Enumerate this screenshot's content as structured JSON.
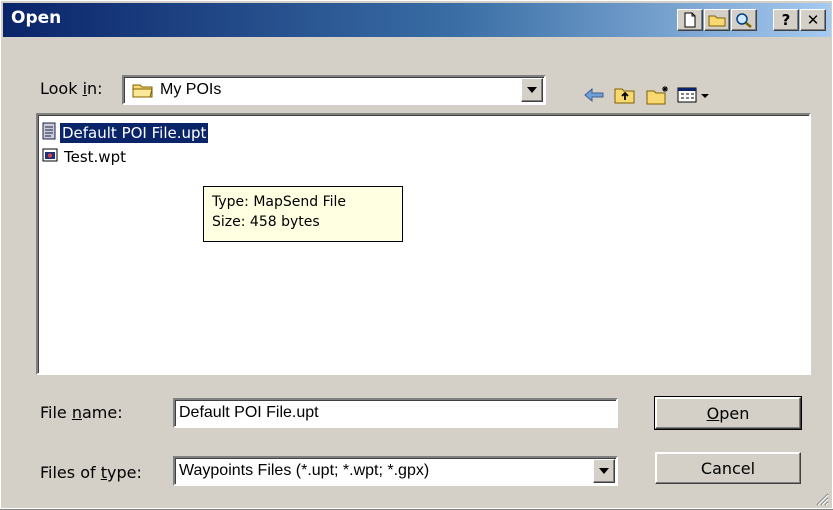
{
  "window": {
    "title": "Open"
  },
  "title_buttons": {
    "help": "?",
    "close": "✕"
  },
  "look_in": {
    "label_pre": "Look ",
    "label_key": "i",
    "label_post": "n:",
    "value": "My POIs"
  },
  "files": [
    {
      "name": "Default POI File.upt",
      "selected": true,
      "icon": "document-icon"
    },
    {
      "name": "Test.wpt",
      "selected": false,
      "icon": "waypoint-file-icon"
    }
  ],
  "tooltip": {
    "type_line": "Type: MapSend File",
    "size_line": "Size: 458 bytes"
  },
  "file_name": {
    "label_pre": "File ",
    "label_key": "n",
    "label_post": "ame:",
    "value": "Default POI File.upt"
  },
  "file_type": {
    "label_pre": "Files of ",
    "label_key": "t",
    "label_post": "ype:",
    "value": "Waypoints Files (*.upt; *.wpt; *.gpx)"
  },
  "buttons": {
    "open_key": "O",
    "open_rest": "pen",
    "cancel": "Cancel"
  },
  "colors": {
    "title_gradient_start": "#0a246a",
    "selection": "#0a246a",
    "tooltip_bg": "#ffffe1",
    "face": "#d4d0c8"
  }
}
